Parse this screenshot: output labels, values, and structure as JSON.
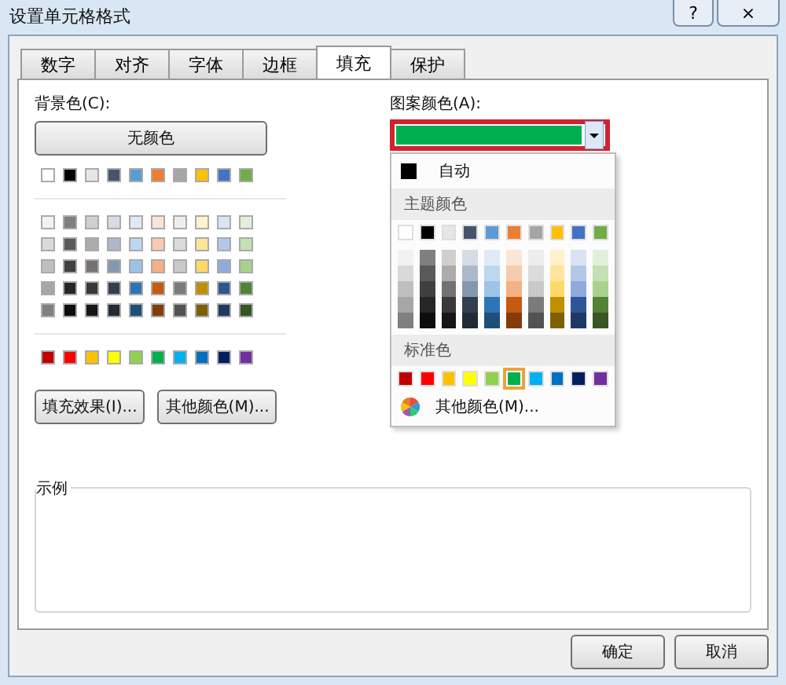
{
  "window": {
    "title": "设置单元格格式",
    "help": "?",
    "close": "×"
  },
  "tabs": [
    {
      "label": "数字",
      "selected": false
    },
    {
      "label": "对齐",
      "selected": false
    },
    {
      "label": "字体",
      "selected": false
    },
    {
      "label": "边框",
      "selected": false
    },
    {
      "label": "填充",
      "selected": true
    },
    {
      "label": "保护",
      "selected": false
    }
  ],
  "background": {
    "label": "背景色(C):",
    "no_color_button": "无颜色",
    "theme_colors": [
      {
        "color": "#ffffff"
      },
      {
        "color": "#000000"
      },
      {
        "color": "#e7e6e6"
      },
      {
        "color": "#44546a"
      },
      {
        "color": "#5b9bd5"
      },
      {
        "color": "#ed7d31"
      },
      {
        "color": "#a5a5a5"
      },
      {
        "color": "#ffc000"
      },
      {
        "color": "#4472c4"
      },
      {
        "color": "#70ad47"
      }
    ],
    "shade_rows": [
      [
        {
          "color": "#f2f2f2"
        },
        {
          "color": "#7f7f7f"
        },
        {
          "color": "#d0cece"
        },
        {
          "color": "#d6dce4"
        },
        {
          "color": "#deebf6"
        },
        {
          "color": "#fbe5d5"
        },
        {
          "color": "#ededed"
        },
        {
          "color": "#fff2cc"
        },
        {
          "color": "#dae3f3"
        },
        {
          "color": "#e2f0d9"
        }
      ],
      [
        {
          "color": "#d9d9d9"
        },
        {
          "color": "#595959"
        },
        {
          "color": "#aeabab"
        },
        {
          "color": "#adb9ca"
        },
        {
          "color": "#bdd7ee"
        },
        {
          "color": "#f7cbac"
        },
        {
          "color": "#dbdbdb"
        },
        {
          "color": "#fee599"
        },
        {
          "color": "#b4c7e7"
        },
        {
          "color": "#c5e0b4"
        }
      ],
      [
        {
          "color": "#bfbfbf"
        },
        {
          "color": "#404040"
        },
        {
          "color": "#757171"
        },
        {
          "color": "#8497b0"
        },
        {
          "color": "#9dc3e6"
        },
        {
          "color": "#f4b183"
        },
        {
          "color": "#c9c9c9"
        },
        {
          "color": "#ffd966"
        },
        {
          "color": "#8faadc"
        },
        {
          "color": "#a9d18e"
        }
      ],
      [
        {
          "color": "#a6a6a6"
        },
        {
          "color": "#262626"
        },
        {
          "color": "#3a3838"
        },
        {
          "color": "#333f4f"
        },
        {
          "color": "#2e75b5"
        },
        {
          "color": "#c55a11"
        },
        {
          "color": "#7b7b7b"
        },
        {
          "color": "#bf9000"
        },
        {
          "color": "#2f5597"
        },
        {
          "color": "#538135"
        }
      ],
      [
        {
          "color": "#808080"
        },
        {
          "color": "#0d0d0d"
        },
        {
          "color": "#171616"
        },
        {
          "color": "#222a35"
        },
        {
          "color": "#1f4e79"
        },
        {
          "color": "#833c0b"
        },
        {
          "color": "#525252"
        },
        {
          "color": "#7f6000"
        },
        {
          "color": "#203864"
        },
        {
          "color": "#375623"
        }
      ]
    ],
    "standard_colors": [
      {
        "color": "#c00000"
      },
      {
        "color": "#ff0000"
      },
      {
        "color": "#ffc000"
      },
      {
        "color": "#ffff00"
      },
      {
        "color": "#92d050"
      },
      {
        "color": "#00b050"
      },
      {
        "color": "#00b0f0"
      },
      {
        "color": "#0070c0"
      },
      {
        "color": "#002060"
      },
      {
        "color": "#7030a0"
      }
    ],
    "fill_effects_button": "填充效果(I)...",
    "more_colors_button": "其他颜色(M)..."
  },
  "pattern_color": {
    "label": "图案颜色(A):",
    "color": "#00b050",
    "expanded": true,
    "menu": {
      "automatic": "自动",
      "theme_header": "主题颜色",
      "theme_colors": [
        {
          "color": "#ffffff"
        },
        {
          "color": "#000000"
        },
        {
          "color": "#e7e6e6"
        },
        {
          "color": "#44546a"
        },
        {
          "color": "#5b9bd5"
        },
        {
          "color": "#ed7d31"
        },
        {
          "color": "#a5a5a5"
        },
        {
          "color": "#ffc000"
        },
        {
          "color": "#4472c4"
        },
        {
          "color": "#70ad47"
        }
      ],
      "shade_rows": [
        [
          {
            "color": "#f2f2f2"
          },
          {
            "color": "#7f7f7f"
          },
          {
            "color": "#d0cece"
          },
          {
            "color": "#d6dce4"
          },
          {
            "color": "#deebf6"
          },
          {
            "color": "#fbe5d5"
          },
          {
            "color": "#ededed"
          },
          {
            "color": "#fff2cc"
          },
          {
            "color": "#dae3f3"
          },
          {
            "color": "#e2f0d9"
          }
        ],
        [
          {
            "color": "#d9d9d9"
          },
          {
            "color": "#595959"
          },
          {
            "color": "#aeabab"
          },
          {
            "color": "#adb9ca"
          },
          {
            "color": "#bdd7ee"
          },
          {
            "color": "#f7cbac"
          },
          {
            "color": "#dbdbdb"
          },
          {
            "color": "#fee599"
          },
          {
            "color": "#b4c7e7"
          },
          {
            "color": "#c5e0b4"
          }
        ],
        [
          {
            "color": "#bfbfbf"
          },
          {
            "color": "#404040"
          },
          {
            "color": "#757171"
          },
          {
            "color": "#8497b0"
          },
          {
            "color": "#9dc3e6"
          },
          {
            "color": "#f4b183"
          },
          {
            "color": "#c9c9c9"
          },
          {
            "color": "#ffd966"
          },
          {
            "color": "#8faadc"
          },
          {
            "color": "#a9d18e"
          }
        ],
        [
          {
            "color": "#a6a6a6"
          },
          {
            "color": "#262626"
          },
          {
            "color": "#3a3838"
          },
          {
            "color": "#333f4f"
          },
          {
            "color": "#2e75b5"
          },
          {
            "color": "#c55a11"
          },
          {
            "color": "#7b7b7b"
          },
          {
            "color": "#bf9000"
          },
          {
            "color": "#2f5597"
          },
          {
            "color": "#538135"
          }
        ],
        [
          {
            "color": "#808080"
          },
          {
            "color": "#0d0d0d"
          },
          {
            "color": "#171616"
          },
          {
            "color": "#222a35"
          },
          {
            "color": "#1f4e79"
          },
          {
            "color": "#833c0b"
          },
          {
            "color": "#525252"
          },
          {
            "color": "#7f6000"
          },
          {
            "color": "#203864"
          },
          {
            "color": "#375623"
          }
        ]
      ],
      "standard_header": "标准色",
      "standard_colors": [
        {
          "color": "#c00000",
          "selected": false
        },
        {
          "color": "#ff0000",
          "selected": false
        },
        {
          "color": "#ffc000",
          "selected": false
        },
        {
          "color": "#ffff00",
          "selected": false
        },
        {
          "color": "#92d050",
          "selected": false
        },
        {
          "color": "#00b050",
          "selected": true
        },
        {
          "color": "#00b0f0",
          "selected": false
        },
        {
          "color": "#0070c0",
          "selected": false
        },
        {
          "color": "#002060",
          "selected": false
        },
        {
          "color": "#7030a0",
          "selected": false
        }
      ],
      "more_colors": "其他颜色(M)..."
    }
  },
  "sample": {
    "label": "示例"
  },
  "buttons": {
    "ok": "确定",
    "cancel": "取消"
  }
}
